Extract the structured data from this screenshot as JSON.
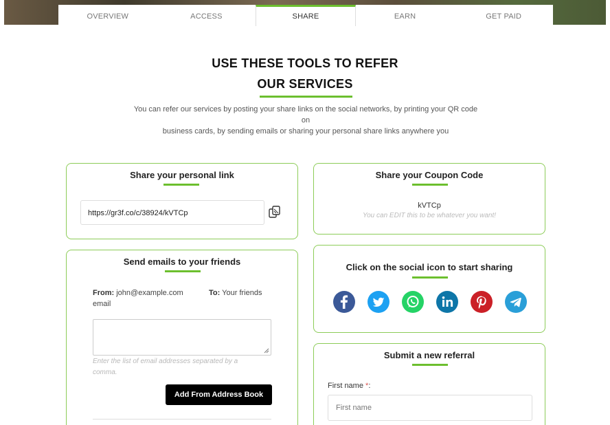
{
  "tabs": [
    {
      "label": "OVERVIEW"
    },
    {
      "label": "ACCESS"
    },
    {
      "label": "SHARE"
    },
    {
      "label": "EARN"
    },
    {
      "label": "GET PAID"
    }
  ],
  "active_tab": "SHARE",
  "header": {
    "title_line1": "USE THESE TOOLS TO REFER",
    "title_line2": "OUR SERVICES",
    "intro_line1": "You can refer our services by posting your share links on the social networks, by printing your QR code on",
    "intro_line2": "business cards, by sending emails or sharing your personal share links anywhere you"
  },
  "personal_link": {
    "title": "Share your personal link",
    "url": "https://gr3f.co/c/38924/kVTCp",
    "copy_icon": "copy-icon"
  },
  "coupon": {
    "title": "Share your Coupon Code",
    "code": "kVTCp",
    "hint": "You can EDIT this to be whatever you want!"
  },
  "emails": {
    "title": "Send emails to your friends",
    "from_label": "From:",
    "from_value": "john@example.com",
    "from_suffix": "email",
    "to_label": "To:",
    "to_value": "Your friends",
    "hint_line1": "Enter the list of email addresses separated by a",
    "hint_line2": "comma.",
    "address_book_button": "Add From Address Book"
  },
  "social": {
    "title": "Click on the social icon to start sharing",
    "icons": [
      {
        "name": "facebook-icon",
        "color": "#3b5998",
        "glyph": "f"
      },
      {
        "name": "twitter-icon",
        "color": "#1da1f2",
        "glyph": "t"
      },
      {
        "name": "whatsapp-icon",
        "color": "#25d366",
        "glyph": "w"
      },
      {
        "name": "linkedin-icon",
        "color": "#0e76a8",
        "glyph": "in"
      },
      {
        "name": "pinterest-icon",
        "color": "#cb2027",
        "glyph": "p"
      },
      {
        "name": "telegram-icon",
        "color": "#2a9fd8",
        "glyph": "tg"
      }
    ]
  },
  "referral": {
    "title": "Submit a new referral",
    "first_name_label": "First name",
    "required_mark": "*",
    "first_name_colon": ":",
    "first_name_placeholder": "First name"
  },
  "colors": {
    "accent": "#6cbf2e",
    "card_border": "#8ccc57",
    "button": "#000000"
  }
}
